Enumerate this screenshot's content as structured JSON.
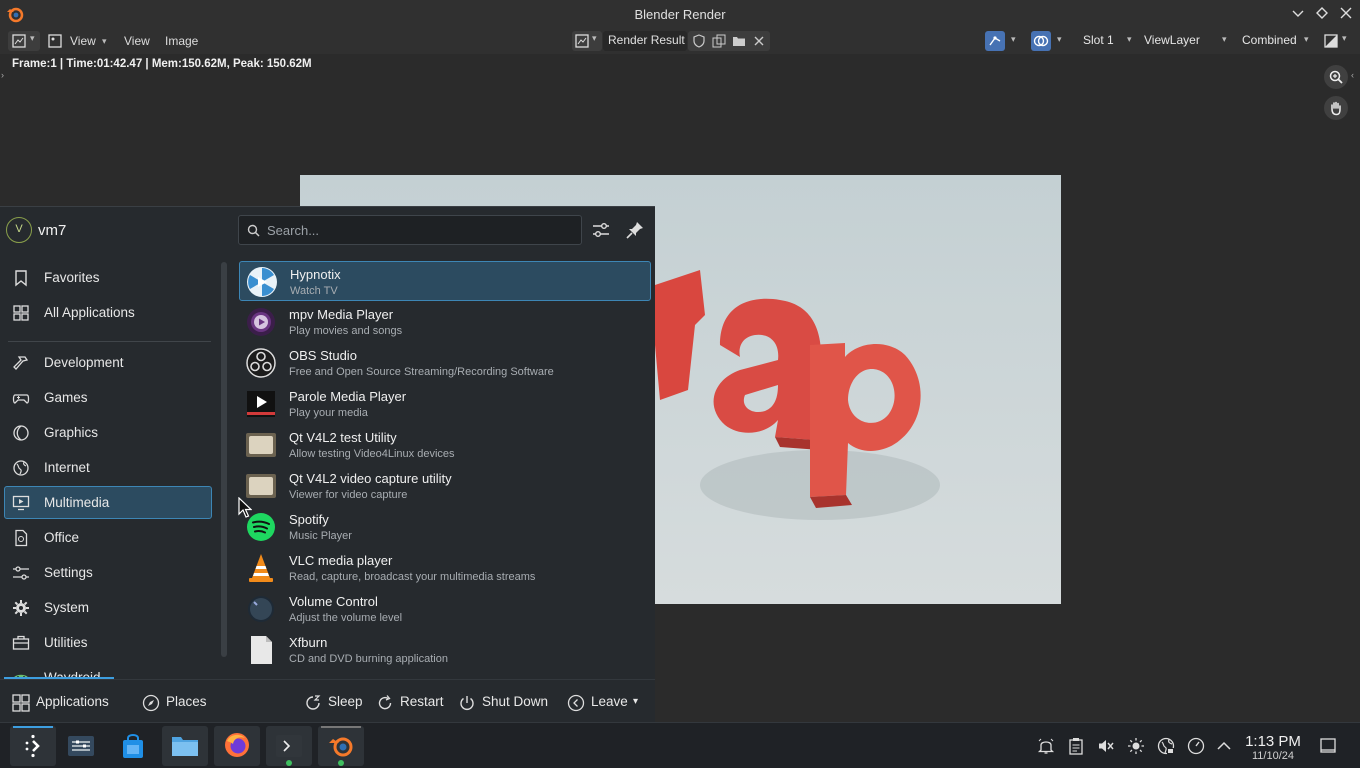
{
  "window": {
    "title": "Blender Render"
  },
  "header": {
    "view_menu1": "View",
    "view_menu2": "View",
    "image_menu": "Image",
    "image_name": "Render Result",
    "slot": "Slot 1",
    "view_layer": "ViewLayer",
    "pass": "Combined"
  },
  "stats": "Frame:1 | Time:01:42.47 | Mem:150.62M, Peak: 150.62M",
  "launcher": {
    "user": {
      "initial": "V",
      "name": "vm7"
    },
    "search_placeholder": "Search...",
    "categories": [
      {
        "label": "Favorites",
        "icon": "bookmark-icon"
      },
      {
        "label": "All Applications",
        "icon": "grid-icon"
      },
      {
        "label": "Development",
        "icon": "hammer-icon"
      },
      {
        "label": "Games",
        "icon": "gamepad-icon"
      },
      {
        "label": "Graphics",
        "icon": "palette-icon"
      },
      {
        "label": "Internet",
        "icon": "globe-icon"
      },
      {
        "label": "Multimedia",
        "icon": "monitor-play-icon",
        "selected": true
      },
      {
        "label": "Office",
        "icon": "document-icon"
      },
      {
        "label": "Settings",
        "icon": "sliders-icon"
      },
      {
        "label": "System",
        "icon": "gear-icon"
      },
      {
        "label": "Utilities",
        "icon": "toolbox-icon"
      },
      {
        "label": "Waydroid",
        "icon": "android-icon"
      }
    ],
    "apps": [
      {
        "name": "Hypnotix",
        "desc": "Watch TV",
        "icon": "hypnotix-icon",
        "selected": true
      },
      {
        "name": "mpv Media Player",
        "desc": "Play movies and songs",
        "icon": "mpv-icon"
      },
      {
        "name": "OBS Studio",
        "desc": "Free and Open Source Streaming/Recording Software",
        "icon": "obs-icon"
      },
      {
        "name": "Parole Media Player",
        "desc": "Play your media",
        "icon": "parole-icon"
      },
      {
        "name": "Qt V4L2 test Utility",
        "desc": "Allow testing Video4Linux devices",
        "icon": "qv4l2-icon"
      },
      {
        "name": "Qt V4L2 video capture utility",
        "desc": "Viewer for video capture",
        "icon": "qvidcap-icon"
      },
      {
        "name": "Spotify",
        "desc": "Music Player",
        "icon": "spotify-icon"
      },
      {
        "name": "VLC media player",
        "desc": "Read, capture, broadcast your multimedia streams",
        "icon": "vlc-icon"
      },
      {
        "name": "Volume Control",
        "desc": "Adjust the volume level",
        "icon": "volume-knob-icon"
      },
      {
        "name": "Xfburn",
        "desc": "CD and DVD burning application",
        "icon": "xfburn-icon"
      }
    ],
    "footer": {
      "applications": "Applications",
      "places": "Places",
      "sleep": "Sleep",
      "restart": "Restart",
      "shutdown": "Shut Down",
      "leave": "Leave"
    }
  },
  "taskbar": {
    "time": "1:13 PM",
    "date": "11/10/24"
  },
  "colors": {
    "accent": "#3d9ee0",
    "selection_bg": "#2c4b60",
    "panel_bg": "#262a2e",
    "blender_bg": "#303030",
    "render_text": "#d94b44"
  }
}
